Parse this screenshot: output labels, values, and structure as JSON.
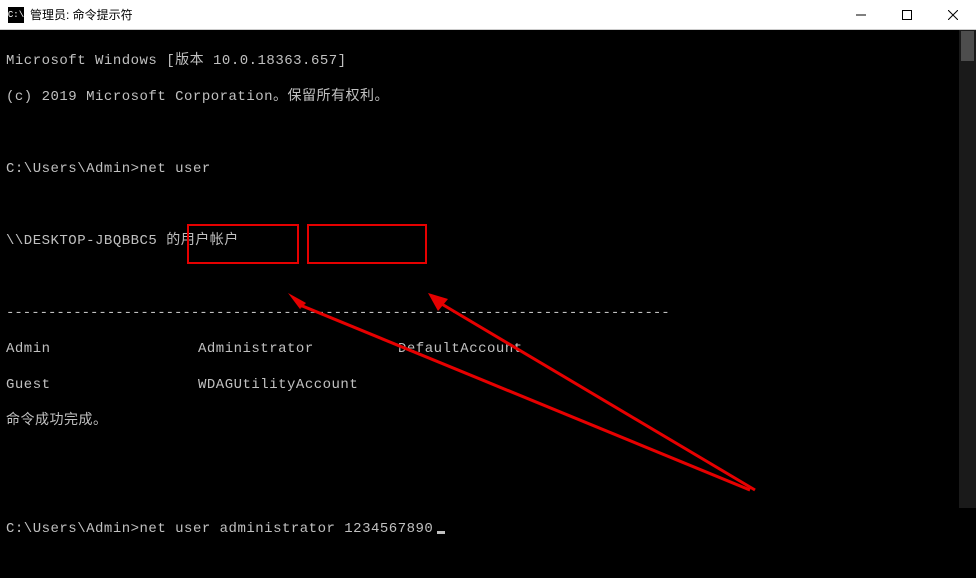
{
  "titlebar": {
    "title": "管理员: 命令提示符",
    "icon_text": "C:\\"
  },
  "terminal": {
    "version_line": "Microsoft Windows [版本 10.0.18363.657]",
    "copyright_line": "(c) 2019 Microsoft Corporation。保留所有权利。",
    "prompt1_prefix": "C:\\Users\\Admin>",
    "cmd1": "net user",
    "accounts_header": "\\\\DESKTOP-JBQBBC5 的用户帐户",
    "divider": "-------------------------------------------------------------------------------",
    "row1": {
      "a": "Admin",
      "b": "Administrator",
      "c": "DefaultAccount"
    },
    "row2": {
      "a": "Guest",
      "b": "WDAGUtilityAccount",
      "c": ""
    },
    "success_msg": "命令成功完成。",
    "prompt2_prefix": "C:\\Users\\Admin>",
    "cmd2_base": "net user",
    "cmd2_arg1": "administrator",
    "cmd2_arg2": "1234567890"
  },
  "colors": {
    "annotation": "#e60000"
  }
}
